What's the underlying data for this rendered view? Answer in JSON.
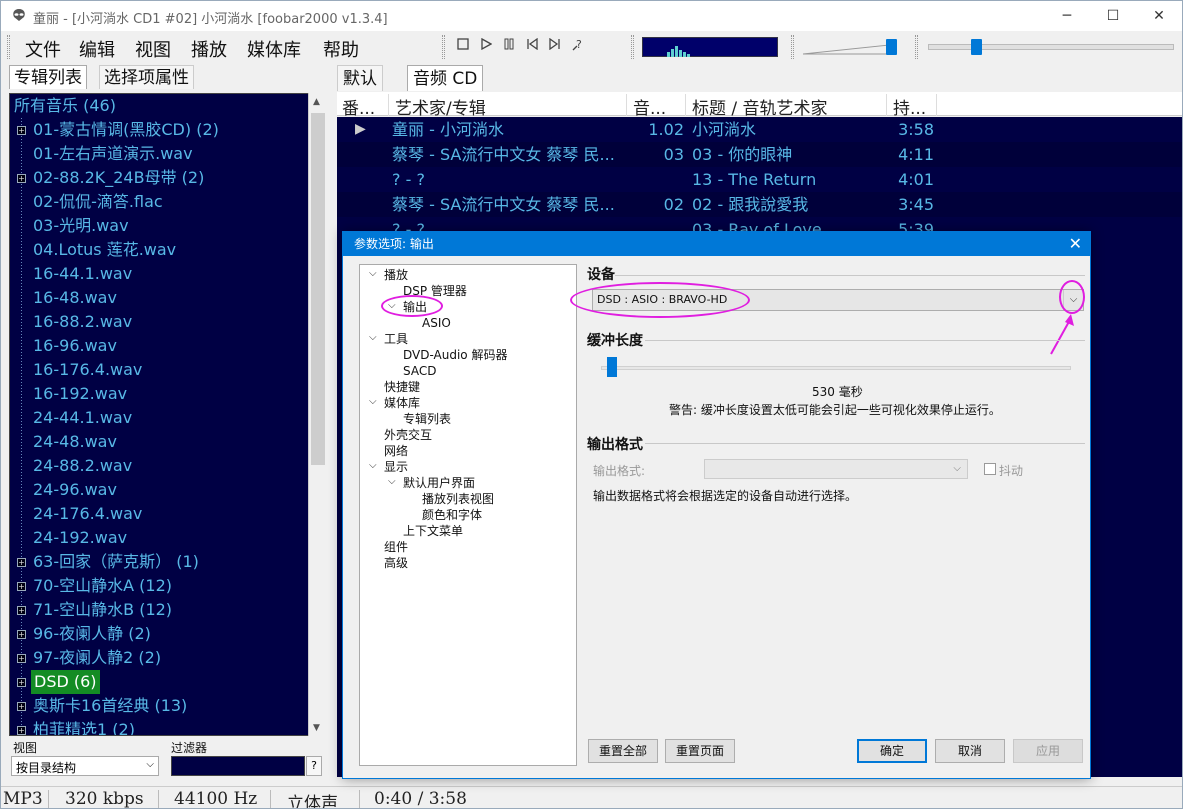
{
  "window": {
    "title": "童丽 - [小河淌水 CD1 #02] 小河淌水   [foobar2000 v1.3.4]"
  },
  "menu": [
    "文件",
    "编辑",
    "视图",
    "播放",
    "媒体库",
    "帮助"
  ],
  "toolbar": {
    "volume": 0.88,
    "seek": 0.17
  },
  "left_tabs": [
    "专辑列表",
    "选择项属性"
  ],
  "album_tree": [
    {
      "label": "所有音乐 (46)",
      "expandable": false,
      "root": true
    },
    {
      "label": "01-蒙古情调(黑胶CD) (2)",
      "expandable": true
    },
    {
      "label": "01-左右声道演示.wav",
      "expandable": false
    },
    {
      "label": "02-88.2K_24B母带 (2)",
      "expandable": true
    },
    {
      "label": "02-侃侃-滴答.flac",
      "expandable": false
    },
    {
      "label": "03-光明.wav",
      "expandable": false
    },
    {
      "label": "04.Lotus 莲花.wav",
      "expandable": false
    },
    {
      "label": "16-44.1.wav",
      "expandable": false
    },
    {
      "label": "16-48.wav",
      "expandable": false
    },
    {
      "label": "16-88.2.wav",
      "expandable": false
    },
    {
      "label": "16-96.wav",
      "expandable": false
    },
    {
      "label": "16-176.4.wav",
      "expandable": false
    },
    {
      "label": "16-192.wav",
      "expandable": false
    },
    {
      "label": "24-44.1.wav",
      "expandable": false
    },
    {
      "label": "24-48.wav",
      "expandable": false
    },
    {
      "label": "24-88.2.wav",
      "expandable": false
    },
    {
      "label": "24-96.wav",
      "expandable": false
    },
    {
      "label": "24-176.4.wav",
      "expandable": false
    },
    {
      "label": "24-192.wav",
      "expandable": false
    },
    {
      "label": "63-回家（萨克斯） (1)",
      "expandable": true
    },
    {
      "label": "70-空山静水A (12)",
      "expandable": true
    },
    {
      "label": "71-空山静水B (12)",
      "expandable": true
    },
    {
      "label": "96-夜阑人静 (2)",
      "expandable": true
    },
    {
      "label": "97-夜阑人静2 (2)",
      "expandable": true
    },
    {
      "label": "DSD (6)",
      "expandable": true,
      "selected": true
    },
    {
      "label": "奥斯卡16首经典 (13)",
      "expandable": true
    },
    {
      "label": "柏菲精选1 (2)",
      "expandable": true
    }
  ],
  "left_bottom": {
    "view_label": "视图",
    "filter_label": "过滤器",
    "view_value": "按目录结构",
    "filter_help": "?"
  },
  "right_tabs": [
    "默认",
    "音频 CD"
  ],
  "playlist": {
    "columns": [
      "番...",
      "艺术家/专辑",
      "音...",
      "标题 / 音轨艺术家",
      "持..."
    ],
    "rows": [
      {
        "playing": true,
        "artist_album": "童丽 - 小河淌水",
        "track": "1.02",
        "title": "小河淌水",
        "duration": "3:58"
      },
      {
        "playing": false,
        "artist_album": "蔡琴 - SA流行中文女 蔡琴 民...",
        "track": "03",
        "title": "03 - 你的眼神",
        "duration": "4:11"
      },
      {
        "playing": false,
        "artist_album": "? - ?",
        "track": "",
        "title": "13 - The Return",
        "duration": "4:01"
      },
      {
        "playing": false,
        "artist_album": "蔡琴 - SA流行中文女 蔡琴 民...",
        "track": "02",
        "title": "02 - 跟我說愛我",
        "duration": "3:45"
      },
      {
        "playing": false,
        "artist_album": "? - ?",
        "track": "",
        "title": "03 - Ray of Love",
        "duration": "5:39"
      }
    ]
  },
  "status": [
    "MP3",
    "320 kbps",
    "44100 Hz",
    "立体声",
    "0:40 / 3:58"
  ],
  "prefs": {
    "title": "参数选项: 输出",
    "tree": [
      {
        "label": "播放",
        "level": 0,
        "toggle": "expanded"
      },
      {
        "label": "DSP 管理器",
        "level": 1
      },
      {
        "label": "输出",
        "level": 1,
        "toggle": "expanded",
        "selected": true
      },
      {
        "label": "ASIO",
        "level": 2
      },
      {
        "label": "工具",
        "level": 0,
        "toggle": "expanded"
      },
      {
        "label": "DVD-Audio 解码器",
        "level": 1
      },
      {
        "label": "SACD",
        "level": 1
      },
      {
        "label": "快捷键",
        "level": 0
      },
      {
        "label": "媒体库",
        "level": 0,
        "toggle": "expanded"
      },
      {
        "label": "专辑列表",
        "level": 1
      },
      {
        "label": "外壳交互",
        "level": 0
      },
      {
        "label": "网络",
        "level": 0
      },
      {
        "label": "显示",
        "level": 0,
        "toggle": "expanded"
      },
      {
        "label": "默认用户界面",
        "level": 1,
        "toggle": "expanded"
      },
      {
        "label": "播放列表视图",
        "level": 2
      },
      {
        "label": "颜色和字体",
        "level": 2
      },
      {
        "label": "上下文菜单",
        "level": 1
      },
      {
        "label": "组件",
        "level": 0
      },
      {
        "label": "高级",
        "level": 0
      }
    ],
    "device_heading": "设备",
    "device_value": "DSD : ASIO : BRAVO-HD",
    "buffer_heading": "缓冲长度",
    "buffer_level": 0.02,
    "buffer_value": "530 毫秒",
    "buffer_warning": "警告: 缓冲长度设置太低可能会引起一些可视化效果停止运行。",
    "format_heading": "输出格式",
    "format_label": "输出格式:",
    "dither_label": "抖动",
    "format_note": "输出数据格式将会根据选定的设备自动进行选择。",
    "buttons": {
      "reset_all": "重置全部",
      "reset_page": "重置页面",
      "ok": "确定",
      "cancel": "取消",
      "apply": "应用"
    }
  }
}
